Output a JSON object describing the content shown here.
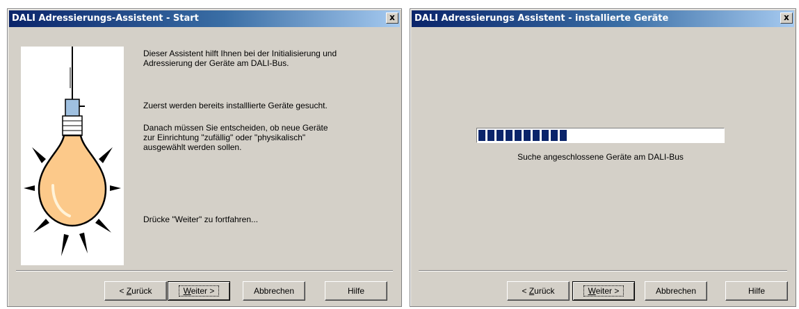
{
  "dialog1": {
    "title": "DALI Adressierungs-Assistent - Start",
    "close_label": "x",
    "text": {
      "intro_line1": "Dieser Assistent hilft Ihnen bei der Initialisierung und",
      "intro_line2": "Adressierung der Geräte am DALI-Bus.",
      "search_line": "Zuerst werden bereits installlierte Geräte gesucht.",
      "decide_line1": "Danach müssen Sie entscheiden, ob neue Geräte",
      "decide_line2": "zur Einrichtung \"zufällig\" oder \"physikalisch\"",
      "decide_line3": "ausgewählt werden sollen.",
      "continue_line": "Drücke \"Weiter\" zu fortfahren..."
    },
    "buttons": {
      "back_prefix": "< ",
      "back_accel": "Z",
      "back_rest": "urück",
      "next_accel": "W",
      "next_rest": "eiter >",
      "cancel": "Abbrechen",
      "help": "Hilfe"
    },
    "icons": {
      "illustration": "light-bulb-icon"
    }
  },
  "dialog2": {
    "title": "DALI Adressierungs Assistent - installierte Geräte",
    "close_label": "x",
    "progress_fraction": 0.36,
    "status": "Suche angeschlossene Geräte am DALI-Bus",
    "buttons": {
      "back_prefix": "< ",
      "back_accel": "Z",
      "back_rest": "urück",
      "next_accel": "W",
      "next_rest": "eiter >",
      "cancel": "Abbrechen",
      "help": "Hilfe"
    }
  },
  "colors": {
    "titlebar_start": "#0a246a",
    "titlebar_end": "#a6caf0",
    "dialog_face": "#d4d0c8",
    "progress_block": "#0a246a",
    "bulb": "#fcc98a"
  }
}
